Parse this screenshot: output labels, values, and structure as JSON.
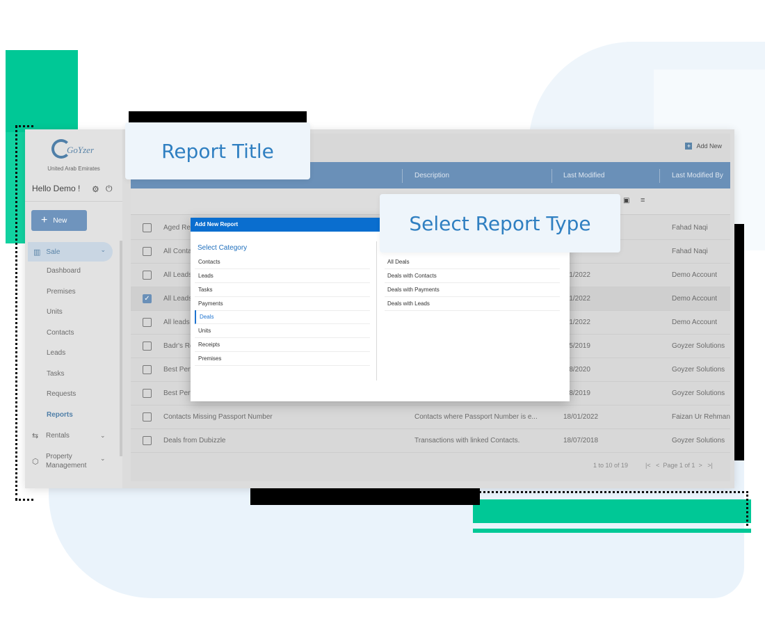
{
  "callouts": {
    "report_title": "Report Title",
    "select_report_type": "Select Report Type"
  },
  "brand": {
    "logo_text": "GoYzer",
    "tagline": "United Arab Emirates"
  },
  "sidebar": {
    "greeting": "Hello Demo !",
    "new_button": "New",
    "sale_label": "Sale",
    "sale_subitems": [
      "Dashboard",
      "Premises",
      "Units",
      "Contacts",
      "Leads",
      "Tasks",
      "Requests",
      "Reports"
    ],
    "active_subitem": "Reports",
    "groups": [
      "Rentals",
      "Property\nManagement"
    ]
  },
  "toolbar": {
    "add_new": "Add New"
  },
  "table": {
    "columns": [
      "Description",
      "Last Modified",
      "Last Modified By"
    ],
    "rows": [
      {
        "title": "Aged Re",
        "description": "",
        "last_modified": "",
        "by": "Fahad Naqi",
        "checked": false
      },
      {
        "title": "All Conta",
        "description": "",
        "last_modified": "",
        "by": "Fahad Naqi",
        "checked": false
      },
      {
        "title": "All Leads",
        "description": "",
        "last_modified": "/01/2022",
        "by": "Demo Account",
        "checked": false
      },
      {
        "title": "All Leads",
        "description": "",
        "last_modified": "/01/2022",
        "by": "Demo Account",
        "checked": true
      },
      {
        "title": "All leads",
        "description": "",
        "last_modified": "/01/2022",
        "by": "Demo Account",
        "checked": false
      },
      {
        "title": "Badr's Re",
        "description": "",
        "last_modified": "/05/2019",
        "by": "Goyzer Solutions",
        "checked": false
      },
      {
        "title": "Best Perf",
        "description": "",
        "last_modified": "/08/2020",
        "by": "Goyzer Solutions",
        "checked": false
      },
      {
        "title": "Best Perf",
        "description": "",
        "last_modified": "/08/2019",
        "by": "Goyzer Solutions",
        "checked": false
      },
      {
        "title": "Contacts Missing Passport Number",
        "description": "Contacts where Passport Number is e...",
        "last_modified": "18/01/2022",
        "by": "Faizan Ur Rehman",
        "checked": false
      },
      {
        "title": "Deals from Dubizzle",
        "description": "Transactions with linked Contacts.",
        "last_modified": "18/07/2018",
        "by": "Goyzer Solutions",
        "checked": false
      }
    ],
    "pagination": {
      "count": "1 to 10 of 19",
      "first": "|<",
      "prev": "<",
      "page": "Page 1 of 1",
      "next": ">",
      "last": ">|"
    }
  },
  "modal": {
    "title": "Add New Report",
    "category_heading": "Select Category",
    "categories": [
      "Contacts",
      "Leads",
      "Tasks",
      "Payments",
      "Deals",
      "Units",
      "Receipts",
      "Premises"
    ],
    "active_category": "Deals",
    "report_types": [
      "All Deals",
      "Deals with Contacts",
      "Deals with Payments",
      "Deals with Leads"
    ]
  },
  "colors": {
    "accent": "#0a6ecf",
    "header_blue": "#6a90b8",
    "callout_text": "#2f7fc1",
    "brand_green": "#00c896"
  }
}
